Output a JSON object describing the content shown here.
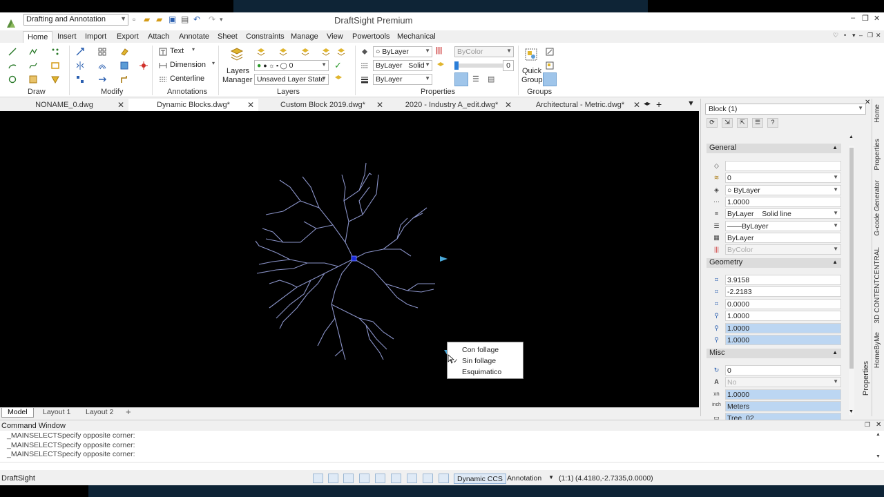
{
  "app": {
    "title": "DraftSight Premium",
    "workspace": "Drafting and Annotation"
  },
  "ribbon": {
    "tabs": [
      "Home",
      "Insert",
      "Import",
      "Export",
      "Attach",
      "Annotate",
      "Sheet",
      "Constraints",
      "Manage",
      "View",
      "Powertools",
      "Mechanical"
    ],
    "groups": {
      "draw": "Draw",
      "modify": "Modify",
      "annotations": "Annotations",
      "layers": "Layers",
      "properties": "Properties",
      "groups": "Groups"
    },
    "annotations": {
      "text": "Text",
      "dimension": "Dimension",
      "centerline": "Centerline"
    },
    "layers": {
      "manager_line1": "Layers",
      "manager_line2": "Manager",
      "layer_combo": "0",
      "state_combo": "Unsaved Layer State"
    },
    "properties": {
      "color": "ByLayer",
      "linestyle": "ByLayer",
      "linestyle_kind": "Solid",
      "lineweight": "ByLayer",
      "transparency_by": "ByColor",
      "transparency_value": "0"
    },
    "quick_group": {
      "line1": "Quick",
      "line2": "Group"
    }
  },
  "doc_tabs": [
    {
      "label": "NONAME_0.dwg"
    },
    {
      "label": "Dynamic Blocks.dwg*"
    },
    {
      "label": "Custom Block 2019.dwg*"
    },
    {
      "label": "2020 - Industry A_edit.dwg*"
    },
    {
      "label": "Architectural - Metric.dwg*"
    }
  ],
  "context_menu": {
    "items": [
      "Con follage",
      "Sin follage",
      "Esquimatico"
    ],
    "checked": "Sin follage"
  },
  "layout_tabs": [
    "Model",
    "Layout 1",
    "Layout 2"
  ],
  "properties_panel": {
    "selection": "Block (1)",
    "sections": {
      "general": "General",
      "geometry": "Geometry",
      "misc": "Misc"
    },
    "general": {
      "handle": "",
      "layer": "0",
      "color": "ByLayer",
      "scale": "1.0000",
      "linestyle": "ByLayer",
      "linestyle_kind": "Solid line",
      "lineweight": "——ByLayer",
      "transparency": "ByLayer",
      "print_style": "ByColor"
    },
    "geometry": {
      "pos_x": "3.9158",
      "pos_y": "-2.2183",
      "pos_z": "0.0000",
      "scale_x": "1.0000",
      "scale_y": "1.0000",
      "scale_z": "1.0000"
    },
    "misc": {
      "rotation": "0",
      "annotative": "No",
      "unit_factor": "1.0000",
      "units": "Meters",
      "name": "Tree_02"
    }
  },
  "vertical_tabs": [
    "Home",
    "Properties",
    "G-code Generator",
    "3D CONTENTCENTRAL",
    "HomeByMe"
  ],
  "properties_side_label": "Properties",
  "command_window": {
    "title": "Command Window",
    "lines": [
      "_MAINSELECTSpecify opposite corner:",
      "_MAINSELECTSpecify opposite corner:",
      "_MAINSELECTSpecify opposite corner:"
    ]
  },
  "status": {
    "app_name": "DraftSight",
    "dynamic_ccs": "Dynamic CCS",
    "annotation": "Annotation",
    "scale": "(1:1)",
    "coords": "(4.4180,-2.7335,0.0000)"
  }
}
